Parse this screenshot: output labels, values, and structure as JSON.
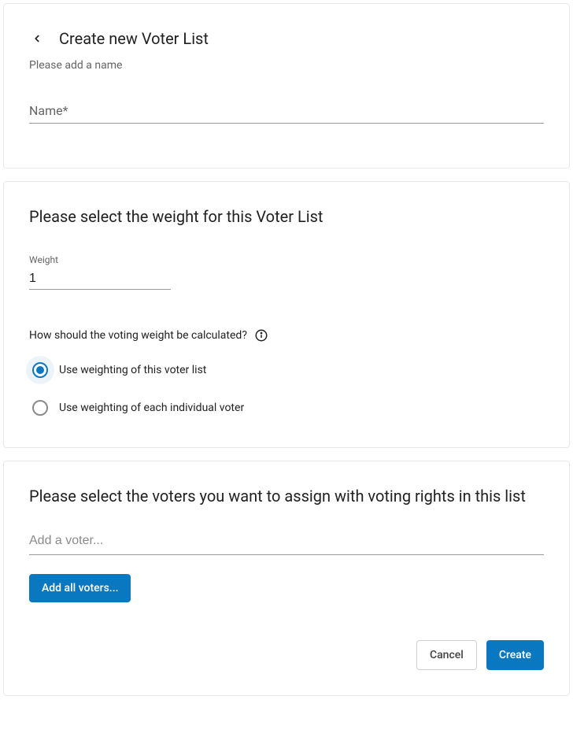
{
  "header": {
    "title": "Create new Voter List",
    "subtitle": "Please add a name"
  },
  "name_field": {
    "label": "Name*",
    "value": ""
  },
  "weight_section": {
    "title": "Please select the weight for this Voter List",
    "weight_label": "Weight",
    "weight_value": "1",
    "question": "How should the voting weight be calculated?",
    "options": [
      {
        "label": "Use weighting of this voter list",
        "selected": true
      },
      {
        "label": "Use weighting of each individual voter",
        "selected": false
      }
    ]
  },
  "voters_section": {
    "title": "Please select the voters you want to assign with voting rights in this list",
    "add_placeholder": "Add a voter...",
    "add_all_label": "Add all voters..."
  },
  "footer": {
    "cancel_label": "Cancel",
    "create_label": "Create"
  }
}
